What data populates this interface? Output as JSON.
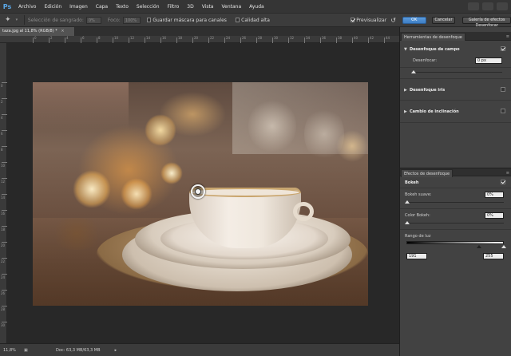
{
  "app": {
    "logo": "Ps"
  },
  "menu": [
    "Archivo",
    "Edición",
    "Imagen",
    "Capa",
    "Texto",
    "Selección",
    "Filtro",
    "3D",
    "Vista",
    "Ventana",
    "Ayuda"
  ],
  "options_bar": {
    "selection_label": "Selección de sangrado:",
    "selection_value": "0%",
    "focus_label": "Foco:",
    "focus_value": "100%",
    "save_mask_label": "Guardar máscara para canales",
    "high_quality_label": "Calidad alta",
    "preview_label": "Previsualizar",
    "ok_label": "OK",
    "cancel_label": "Cancelar",
    "gallery_label": "Galería de efectos Desenfocar"
  },
  "document": {
    "tab_title": "taza.jpg al 11,8% (RGB/8) *",
    "ruler_top": [
      "0",
      "2",
      "4",
      "6",
      "8",
      "10",
      "12",
      "14",
      "16",
      "18",
      "20",
      "22",
      "24",
      "26",
      "28",
      "30",
      "32",
      "34",
      "36",
      "38",
      "40",
      "42",
      "44"
    ],
    "ruler_left": [
      "0",
      "2",
      "4",
      "6",
      "8",
      "10",
      "12",
      "14",
      "16",
      "18",
      "20",
      "22",
      "24",
      "26",
      "28",
      "30"
    ]
  },
  "status_bar": {
    "zoom": "11,8%",
    "doc_info": "Doc: 63,3 MB/63,3 MB"
  },
  "blur_tools_panel": {
    "tab": "Herramientas de desenfoque",
    "field_blur": {
      "title": "Desenfoque de campo",
      "checked": true,
      "blur_label": "Desenfocar:",
      "blur_value": "0 px"
    },
    "iris_blur": {
      "title": "Desenfoque iris",
      "checked": false
    },
    "tilt_shift": {
      "title": "Cambio de inclinación",
      "checked": false
    }
  },
  "blur_effects_panel": {
    "tab": "Efectos de desenfoque",
    "bokeh": {
      "title": "Bokeh",
      "checked": true
    },
    "light_bokeh": {
      "label": "Bokeh suave:",
      "value": "0%"
    },
    "bokeh_color": {
      "label": "Color Bokeh:",
      "value": "0%"
    },
    "light_range": {
      "label": "Rango de luz",
      "low": "191",
      "high": "255"
    }
  }
}
